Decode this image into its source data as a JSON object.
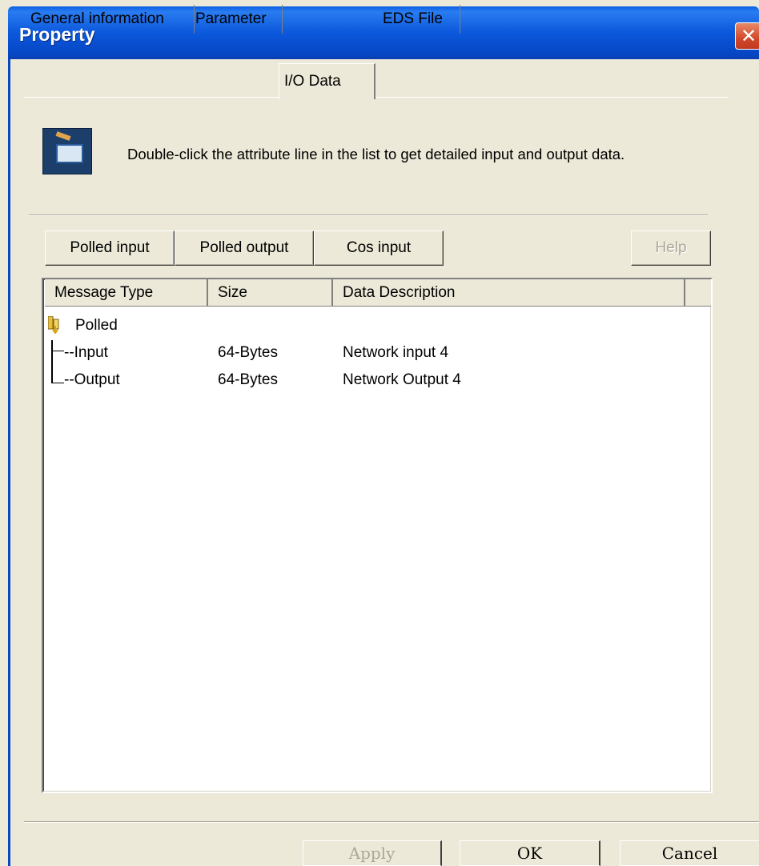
{
  "window": {
    "title": "Property",
    "close_glyph": "✕"
  },
  "tabs": [
    {
      "label": "General information"
    },
    {
      "label": "Parameter"
    },
    {
      "label": "I/O Data"
    },
    {
      "label": "EDS File"
    }
  ],
  "active_tab": "I/O Data",
  "info": {
    "icon": "io-data-icon",
    "text": "Double-click the attribute line in the list to get detailed input and output data."
  },
  "toolbar": {
    "polled_input": "Polled input",
    "polled_output": "Polled output",
    "cos_input": "Cos input",
    "help": "Help"
  },
  "list": {
    "columns": [
      "Message Type",
      "Size",
      "Data Description"
    ],
    "group": {
      "label": "Polled",
      "icon": "folder-io-icon"
    },
    "rows": [
      {
        "type": "--Input",
        "size": "64-Bytes",
        "description": "Network input 4"
      },
      {
        "type": "--Output",
        "size": "64-Bytes",
        "description": "Network Output 4"
      }
    ]
  },
  "footer": {
    "apply": "Apply",
    "ok": "OK",
    "cancel": "Cancel"
  },
  "colors": {
    "titlebar": "#0b58dc",
    "dialog": "#ece9d8",
    "close": "#d2482a"
  }
}
